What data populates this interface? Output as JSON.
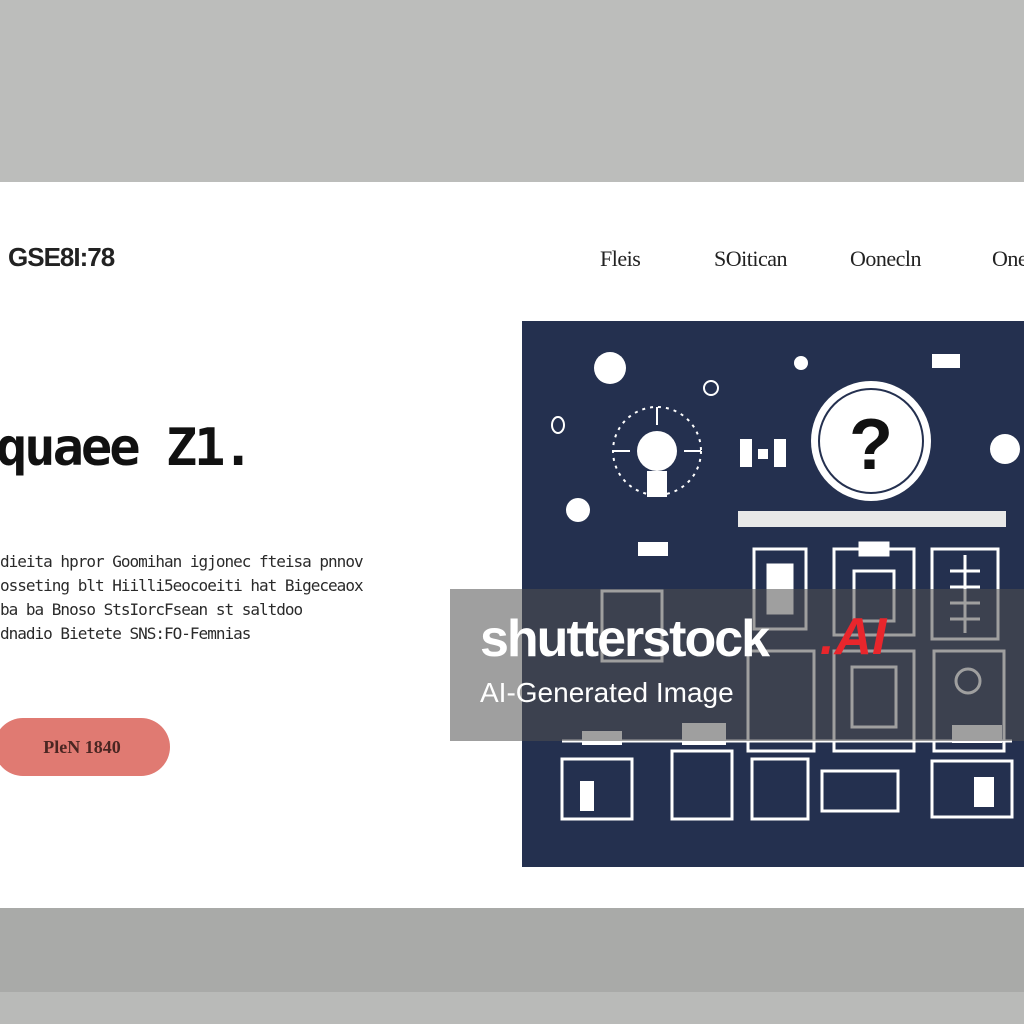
{
  "header": {
    "logo_text": "GSE8I:78",
    "nav": [
      "Fleis",
      "SOitican",
      "Oonecln",
      "One"
    ]
  },
  "hero": {
    "headline": "quaee Z1.",
    "body_lines": [
      "dieita hpror Goomihan igjonec fteisa pnnov",
      "osseting blt Hiilli5eocoeiti hat Bigeceaox",
      "ba ba Bnoso StsIorcFsean st saltdoo",
      "dnadio Bietete SNS:FO-Femnias"
    ],
    "cta_label": "PleN 1840"
  },
  "illustration": {
    "question_mark": "?",
    "background_color": "#24304f"
  },
  "watermark": {
    "brand": "shutterstock",
    "ai_mark": ".AI",
    "caption": "AI-Generated Image",
    "accent_color": "#e8262c"
  }
}
